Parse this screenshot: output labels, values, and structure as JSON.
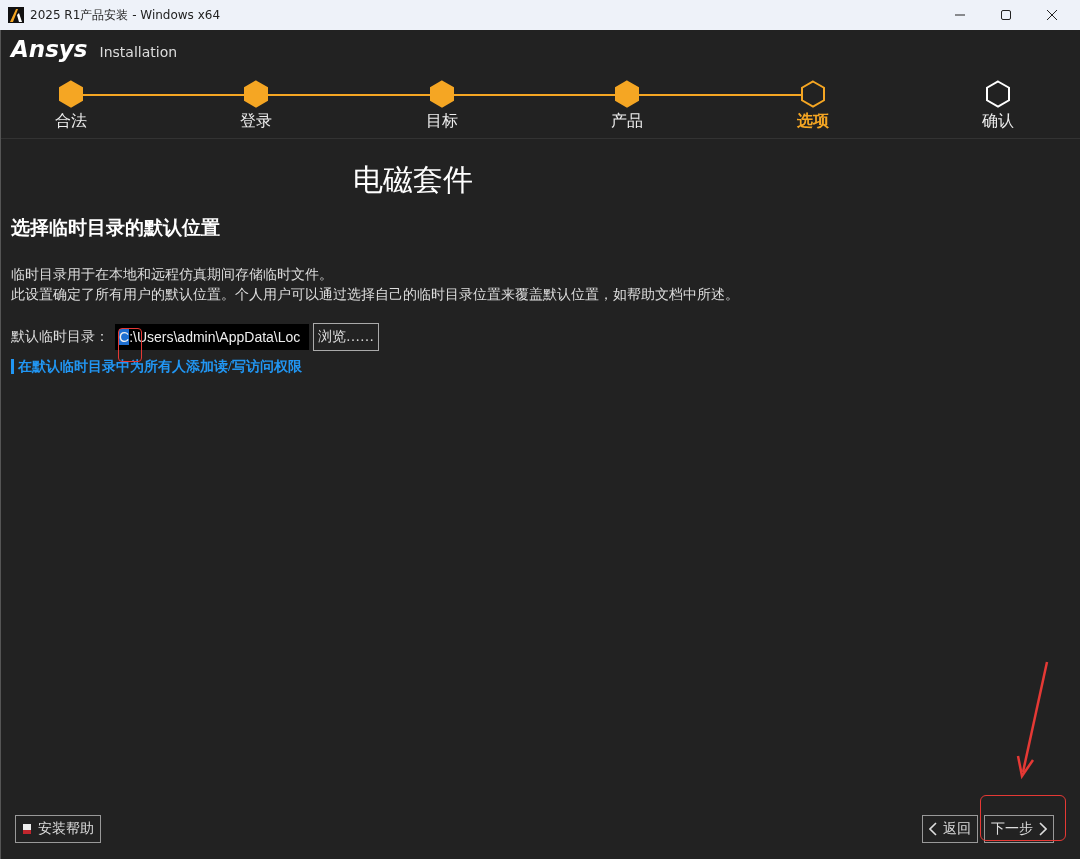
{
  "window": {
    "title": "2025 R1产品安装 - Windows x64"
  },
  "brand": {
    "logo": "Ansys",
    "subtitle": "Installation"
  },
  "steps": [
    {
      "label": "合法",
      "completed": true,
      "selected": false
    },
    {
      "label": "登录",
      "completed": true,
      "selected": false
    },
    {
      "label": "目标",
      "completed": true,
      "selected": false
    },
    {
      "label": "产品",
      "completed": true,
      "selected": false
    },
    {
      "label": "选项",
      "completed": false,
      "selected": true
    },
    {
      "label": "确认",
      "completed": false,
      "selected": false
    }
  ],
  "suite_title": "电磁套件",
  "section_heading": "选择临时目录的默认位置",
  "description": [
    "临时目录用于在本地和远程仿真期间存储临时文件。",
    "此设置确定了所有用户的默认位置。个人用户可以通过选择自己的临时目录位置来覆盖默认位置，如帮助文档中所述。"
  ],
  "temp_dir": {
    "label": "默认临时目录：",
    "value_selected": "C",
    "value_rest": ":\\Users\\admin\\AppData\\Loc",
    "browse_button": "浏览……"
  },
  "permission_link": "在默认临时目录中为所有人添加读/写访问权限",
  "buttons": {
    "help": "安装帮助",
    "back": "返回",
    "next": "下一步"
  }
}
